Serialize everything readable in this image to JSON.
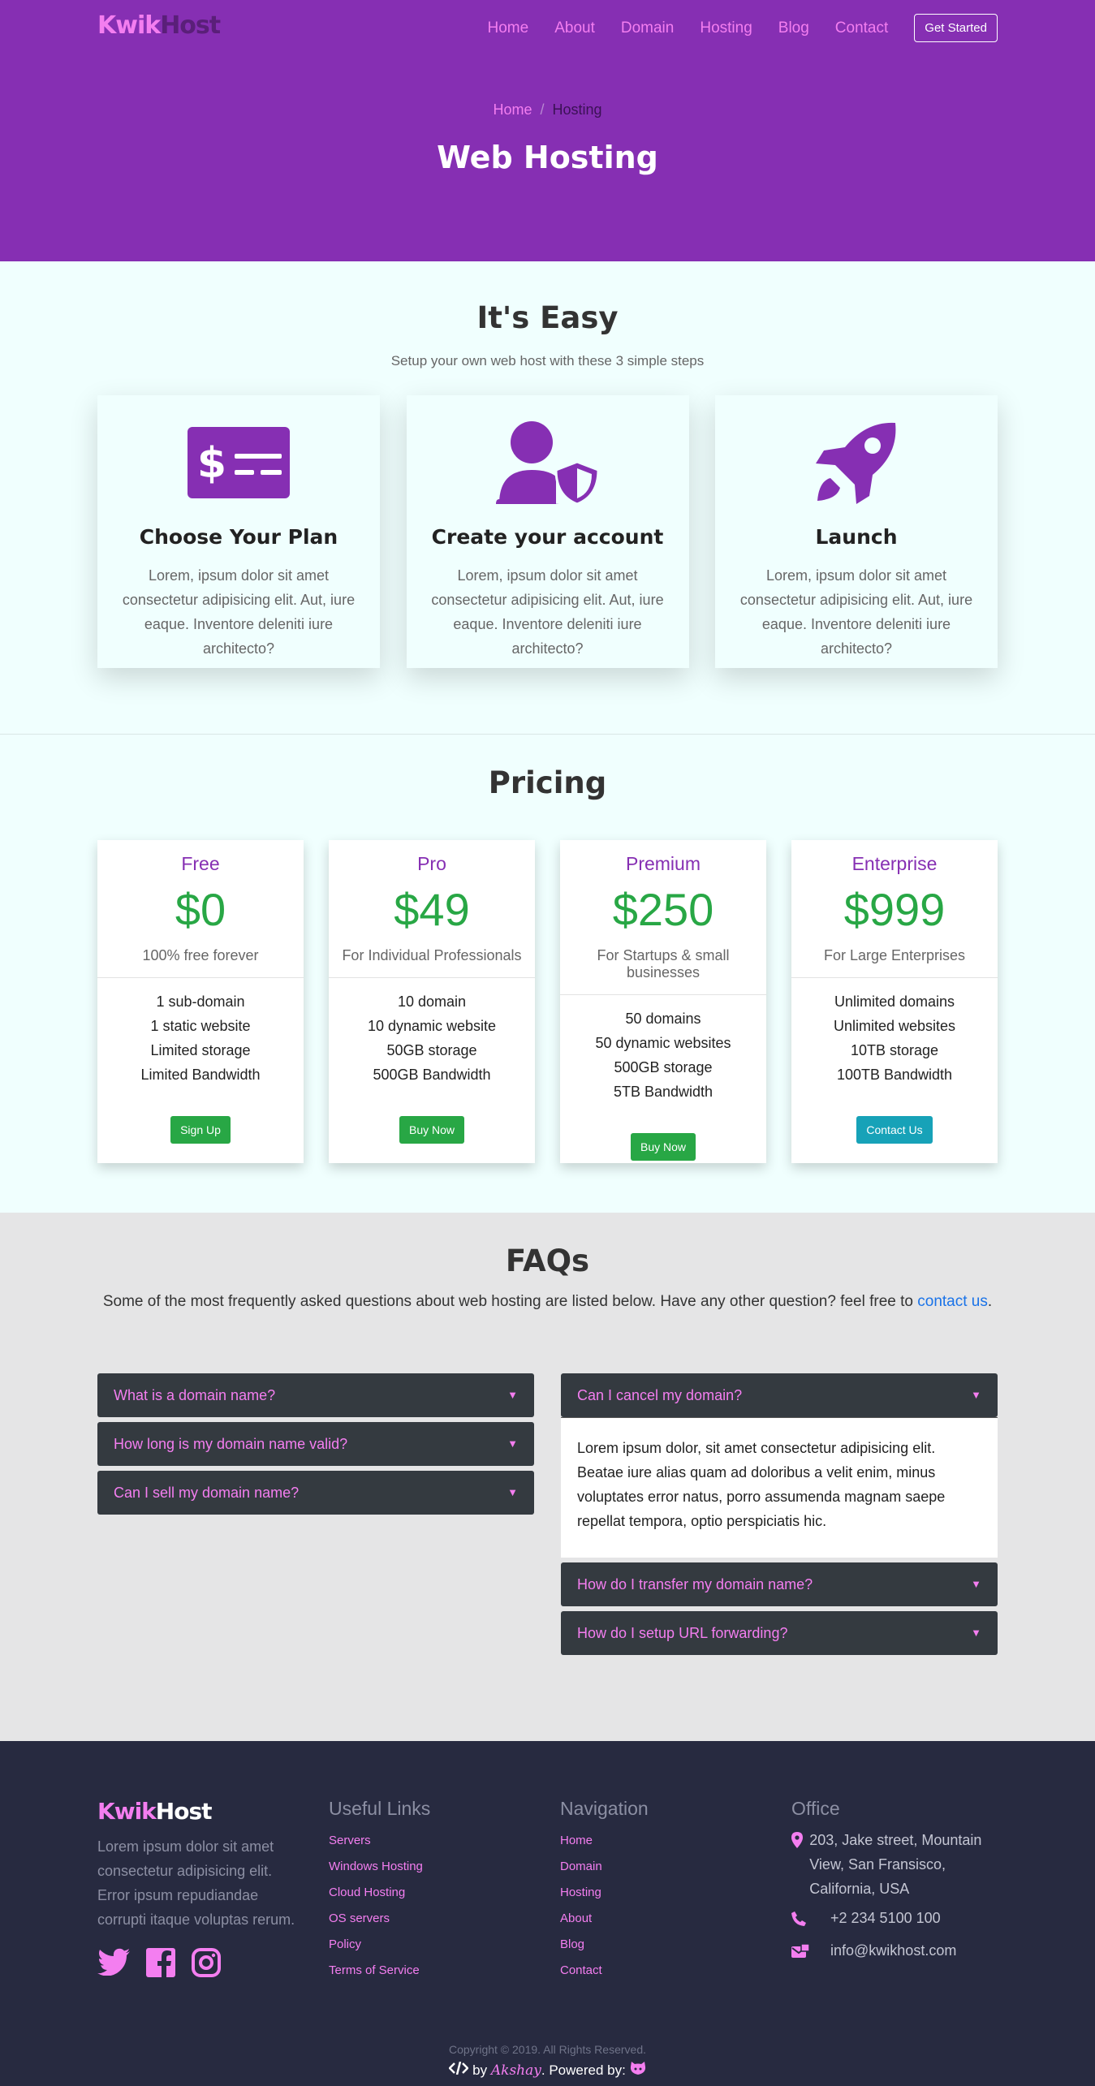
{
  "brand": {
    "part1": "Kwik",
    "part2": "Host"
  },
  "nav": {
    "items": [
      "Home",
      "About",
      "Domain",
      "Hosting",
      "Blog",
      "Contact"
    ],
    "cta": "Get Started"
  },
  "hero": {
    "breadcrumb": {
      "home": "Home",
      "separator": "/",
      "current": "Hosting"
    },
    "title": "Web Hosting"
  },
  "easy": {
    "title": "It's Easy",
    "subtitle": "Setup your own web host with these 3 simple steps",
    "steps": [
      {
        "icon": "money-check-icon",
        "title": "Choose Your Plan",
        "text": "Lorem, ipsum dolor sit amet consectetur adipisicing elit. Aut, iure eaque. Inventore deleniti iure architecto?"
      },
      {
        "icon": "user-shield-icon",
        "title": "Create your account",
        "text": "Lorem, ipsum dolor sit amet consectetur adipisicing elit. Aut, iure eaque. Inventore deleniti iure architecto?"
      },
      {
        "icon": "rocket-icon",
        "title": "Launch",
        "text": "Lorem, ipsum dolor sit amet consectetur adipisicing elit. Aut, iure eaque. Inventore deleniti iure architecto?"
      }
    ]
  },
  "pricing": {
    "title": "Pricing",
    "plans": [
      {
        "name": "Free",
        "price": "$0",
        "desc": "100% free forever",
        "features": [
          "1 sub-domain",
          "1 static website",
          "Limited storage",
          "Limited Bandwidth"
        ],
        "button": "Sign Up"
      },
      {
        "name": "Pro",
        "price": "$49",
        "desc": "For Individual Professionals",
        "features": [
          "10 domain",
          "10 dynamic website",
          "50GB storage",
          "500GB Bandwidth"
        ],
        "button": "Buy Now"
      },
      {
        "name": "Premium",
        "price": "$250",
        "desc": "For Startups & small businesses",
        "features": [
          "50 domains",
          "50 dynamic websites",
          "500GB storage",
          "5TB Bandwidth"
        ],
        "button": "Buy Now"
      },
      {
        "name": "Enterprise",
        "price": "$999",
        "desc": "For Large Enterprises",
        "features": [
          "Unlimited domains",
          "Unlimited websites",
          "10TB storage",
          "100TB Bandwidth"
        ],
        "button": "Contact Us"
      }
    ]
  },
  "faq": {
    "title": "FAQs",
    "intro": "Some of the most frequently asked questions about web hosting are listed below. Have any other question? feel free to ",
    "intro_link": "contact us",
    "intro_end": ".",
    "left": [
      "What is a domain name?",
      "How long is my domain name valid?",
      "Can I sell my domain name?"
    ],
    "right": [
      "Can I cancel my domain?",
      "How do I transfer my domain name?",
      "How do I setup URL forwarding?"
    ],
    "open_answer": "Lorem ipsum dolor, sit amet consectetur adipisicing elit. Beatae iure alias quam ad doloribus a velit enim, minus voluptates error natus, porro assumenda magnam saepe repellat tempora, optio perspiciatis hic."
  },
  "footer": {
    "about": "Lorem ipsum dolor sit amet consectetur adipisicing elit. Error ipsum repudiandae corrupti itaque voluptas rerum.",
    "useful_title": "Useful Links",
    "useful_links": [
      "Servers",
      "Windows Hosting",
      "Cloud Hosting",
      "OS servers",
      "Policy",
      "Terms of Service"
    ],
    "nav_title": "Navigation",
    "nav_links": [
      "Home",
      "Domain",
      "Hosting",
      "About",
      "Blog",
      "Contact"
    ],
    "office_title": "Office",
    "address": "203, Jake street, Mountain View, San Fransisco, California, USA",
    "phone": "+2 234 5100 100",
    "email": "info@kwikhost.com",
    "copyright": "Copyright © 2019. All Rights Reserved.",
    "credit_by": "by",
    "credit_name": "Akshay",
    "credit_powered": ". Powered by:"
  },
  "colors": {
    "primary": "#862fb3",
    "accent": "#f47ef0",
    "success": "#28a745",
    "info": "#17a2b8",
    "footer": "#272a40"
  }
}
